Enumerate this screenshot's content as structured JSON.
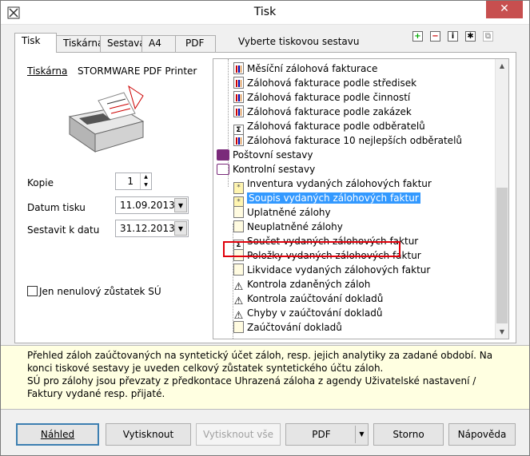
{
  "window": {
    "title": "Tisk",
    "close_glyph": "✕"
  },
  "tabs": [
    {
      "label": "Tisk",
      "active": true
    },
    {
      "label": "Tiskárna",
      "active": false
    },
    {
      "label": "Sestava",
      "active": false
    },
    {
      "label": "A4",
      "active": false
    },
    {
      "label": "PDF",
      "active": false
    }
  ],
  "toolbar": {
    "label": "Vyberte tiskovou sestavu",
    "icons": [
      "add-icon",
      "remove-icon",
      "info-icon",
      "settings-icon",
      "copy-icon"
    ]
  },
  "printer": {
    "link": "Tiskárna",
    "name": "STORMWARE PDF Printer"
  },
  "form": {
    "copies_label": "Kopie",
    "copies_value": "1",
    "print_date_label": "Datum tisku",
    "print_date_value": "11.09.2013",
    "as_of_label": "Sestavit k datu",
    "as_of_value": "31.12.2013",
    "nonzero_label": "Jen nenulový zůstatek SÚ",
    "nonzero_checked": false
  },
  "tree": {
    "items": [
      {
        "label": "Měsíční zálohová fakturace",
        "icon": "chart-icon",
        "level": 2
      },
      {
        "label": "Zálohová fakturace podle středisek",
        "icon": "chart-icon",
        "level": 2
      },
      {
        "label": "Zálohová fakturace podle činností",
        "icon": "chart-icon",
        "level": 2
      },
      {
        "label": "Zálohová fakturace podle zakázek",
        "icon": "chart-icon",
        "level": 2
      },
      {
        "label": "Zálohová fakturace podle odběratelů",
        "icon": "sigma-icon",
        "level": 2
      },
      {
        "label": "Zálohová fakturace 10 nejlepších odběratelů",
        "icon": "chart-icon",
        "level": 2
      },
      {
        "label": "Poštovní sestavy",
        "icon": "book-icon",
        "level": 1
      },
      {
        "label": "Kontrolní sestavy",
        "icon": "open-book-icon",
        "level": 1
      },
      {
        "label": "Inventura vydaných zálohových faktur",
        "icon": "star-icon",
        "level": 2
      },
      {
        "label": "Soupis vydaných zálohových faktur",
        "icon": "star-icon",
        "level": 2,
        "selected": true
      },
      {
        "label": "Uplatněné zálohy",
        "icon": "document-icon",
        "level": 2
      },
      {
        "label": "Neuplatněné zálohy",
        "icon": "document-icon",
        "level": 2
      },
      {
        "label": "Součet vydaných zálohových faktur",
        "icon": "sigma-icon",
        "level": 2
      },
      {
        "label": "Položky vydaných zálohových faktur",
        "icon": "document-icon",
        "level": 2
      },
      {
        "label": "Likvidace vydaných zálohových faktur",
        "icon": "document-icon",
        "level": 2
      },
      {
        "label": "Kontrola zdaněných záloh",
        "icon": "warning-icon",
        "level": 2
      },
      {
        "label": "Kontrola zaúčtování dokladů",
        "icon": "warning-icon",
        "level": 2
      },
      {
        "label": "Chyby v zaúčtování dokladů",
        "icon": "warning-icon",
        "level": 2
      },
      {
        "label": "Zaúčtování dokladů",
        "icon": "document-icon",
        "level": 2
      }
    ]
  },
  "description": {
    "text": "Přehled záloh zaúčtovaných na syntetický účet záloh, resp. jejich analytiky za zadané období. Na konci tiskové sestavy je uveden celkový zůstatek syntetického účtu záloh.",
    "text2": "SÚ pro zálohy jsou převzaty z předkontace Uhrazená záloha z agendy Uživatelské nastavení / Faktury vydané resp. přijaté."
  },
  "buttons": {
    "preview": "Náhled",
    "print": "Vytisknout",
    "print_all": "Vytisknout vše",
    "pdf": "PDF",
    "cancel": "Storno",
    "help": "Nápověda"
  }
}
